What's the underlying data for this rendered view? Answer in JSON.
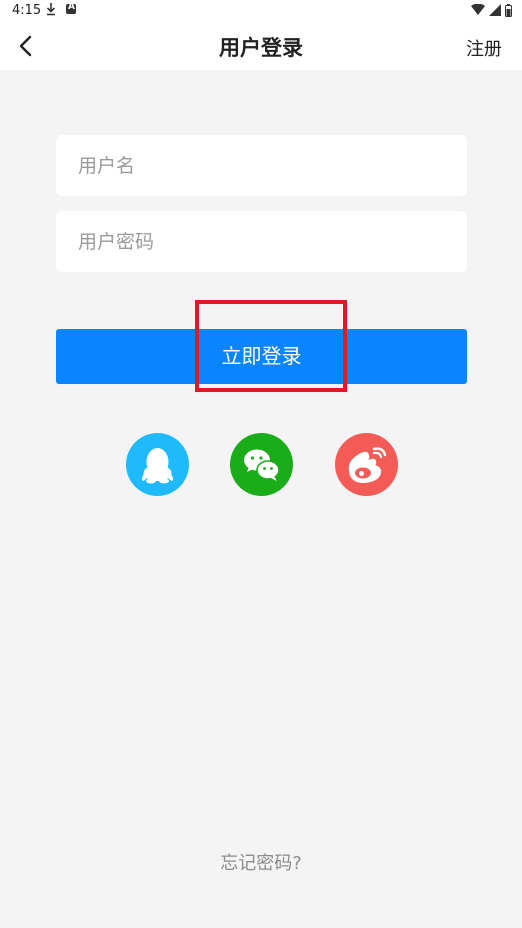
{
  "status_bar": {
    "time": "4:15"
  },
  "header": {
    "title": "用户登录",
    "register_label": "注册"
  },
  "form": {
    "username_placeholder": "用户名",
    "password_placeholder": "用户密码"
  },
  "login_button_label": "立即登录",
  "social_logins": [
    {
      "name": "qq",
      "icon": "qq-penguin-icon",
      "color": "#1ebafc"
    },
    {
      "name": "wechat",
      "icon": "wechat-icon",
      "color": "#1aad19"
    },
    {
      "name": "weibo",
      "icon": "weibo-icon",
      "color": "#f25b56"
    }
  ],
  "forgot_password_label": "忘记密码?",
  "colors": {
    "accent": "#0a84ff",
    "highlight": "#e0182a",
    "background": "#f4f4f4"
  }
}
